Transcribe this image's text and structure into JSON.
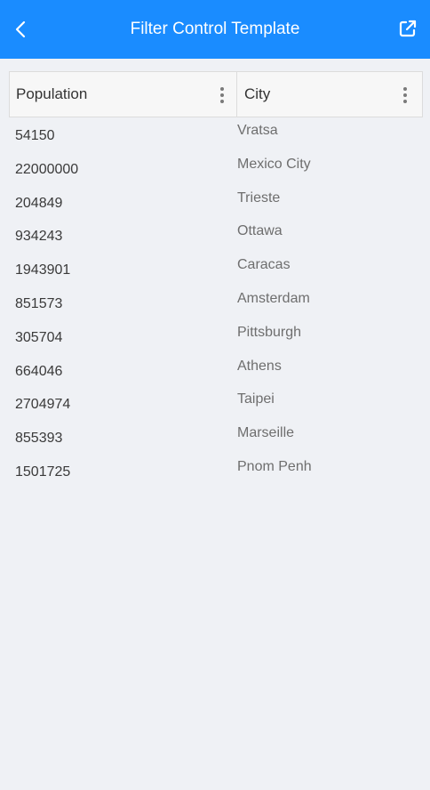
{
  "header": {
    "title": "Filter Control Template",
    "back_icon": "chevron-left-icon",
    "external_icon": "open-external-icon",
    "background": "#1a8cff"
  },
  "grid": {
    "columns": [
      {
        "label": "Population",
        "menu_icon": "more-vertical-icon"
      },
      {
        "label": "City",
        "menu_icon": "more-vertical-icon"
      }
    ],
    "rows": [
      {
        "population": "54150",
        "city": "Vratsa"
      },
      {
        "population": "22000000",
        "city": "Mexico City"
      },
      {
        "population": "204849",
        "city": "Trieste"
      },
      {
        "population": "934243",
        "city": "Ottawa"
      },
      {
        "population": "1943901",
        "city": "Caracas"
      },
      {
        "population": "851573",
        "city": "Amsterdam"
      },
      {
        "population": "305704",
        "city": "Pittsburgh"
      },
      {
        "population": "664046",
        "city": "Athens"
      },
      {
        "population": "2704974",
        "city": "Taipei"
      },
      {
        "population": "855393",
        "city": "Marseille"
      },
      {
        "population": "1501725",
        "city": "Pnom Penh"
      }
    ]
  }
}
